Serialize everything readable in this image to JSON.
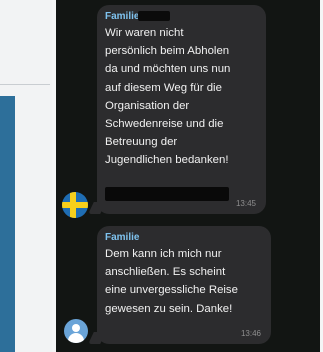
{
  "messages": [
    {
      "sender": "Familie",
      "text": "Wir waren nicht\npersönlich beim Abholen\nda und möchten uns nun\nauf diesem Weg für die\nOrganisation der\nSchwedenreise und die\nBetreuung der\nJugendlichen bedanken!",
      "time": "13:45",
      "avatar_icon": "sweden-flag-icon"
    },
    {
      "sender": "Familie",
      "text": "Dem kann ich mich nur\nanschließen. Es scheint\neine unvergessliche Reise\ngewesen zu sein. Danke!",
      "time": "13:46",
      "avatar_icon": "user-silhouette-icon"
    }
  ],
  "colors": {
    "chat_background": "#121513",
    "bubble": "#2c2c2e",
    "sender_name": "#7fc3ef",
    "left_accent": "#2d6f9a"
  }
}
